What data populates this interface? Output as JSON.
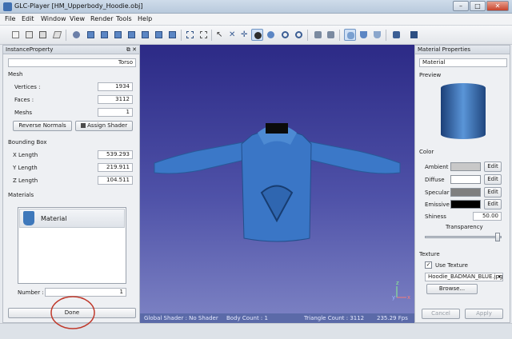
{
  "window": {
    "title": "GLC-Player [HM_Upperbody_Hoodie.obj]"
  },
  "menu": [
    "File",
    "Edit",
    "Window",
    "View",
    "Render",
    "Tools",
    "Help"
  ],
  "toolbar": {
    "icons": [
      "new-icon",
      "open-icon",
      "save-icon",
      "reload-icon",
      "print-icon",
      "front-view-icon",
      "back-view-icon",
      "left-view-icon",
      "right-view-icon",
      "top-view-icon",
      "bottom-view-icon",
      "iso-view-icon",
      "select-icon",
      "zoom-window-icon",
      "select-arrow-icon",
      "pan-icon",
      "move-icon",
      "orbit-icon",
      "turn-icon",
      "zoom-in-icon",
      "zoom-out-icon",
      "snapshot-icon",
      "fullscreen-icon",
      "instance-properties-icon",
      "material-icon",
      "shader-icon",
      "camera-icon",
      "settings-icon"
    ]
  },
  "instance_panel": {
    "title": "InstanceProperty",
    "name_value": "Torso",
    "mesh_title": "Mesh",
    "vertices_label": "Vertices :",
    "vertices_value": "1934",
    "faces_label": "Faces :",
    "faces_value": "3112",
    "meshs_label": "Meshs",
    "meshs_value": "1",
    "reverse_normals": "Reverse Normals",
    "assign_shader": "Assign Shader",
    "bbox_title": "Bounding Box",
    "x_label": "X Length",
    "x_value": "539.293",
    "y_label": "Y Length",
    "y_value": "219.911",
    "z_label": "Z Length",
    "z_value": "104.511",
    "materials_title": "Materials",
    "material_item": "Material",
    "number_label": "Number :",
    "number_value": "1",
    "done": "Done"
  },
  "status": {
    "shader": "Global Shader : No Shader",
    "body": "Body Count : 1",
    "triangle": "Triangle Count : 3112",
    "fps": "235.29 Fps"
  },
  "axes": {
    "x": "x",
    "y": "y",
    "z": "z"
  },
  "material_panel": {
    "title": "Material Properties",
    "name_value": "Material",
    "preview_title": "Preview",
    "color_title": "Color",
    "ambient_label": "Ambient",
    "diffuse_label": "Diffuse",
    "specular_label": "Specular",
    "emissive_label": "Emissive",
    "edit": "Edit",
    "shiness_label": "Shiness",
    "shiness_value": "50.00",
    "transparency_label": "Transparency",
    "transparency_level": 1.0,
    "texture_title": "Texture",
    "use_texture_label": "Use Texture",
    "use_texture_checked": true,
    "texture_file": "Hoodie_BADMAN_BLUE.jpg",
    "browse": "Browse...",
    "cancel": "Cancel",
    "apply": "Apply",
    "colors": {
      "ambient": "#c8c8c8",
      "diffuse": "#ffffff",
      "specular": "#7f7f7f",
      "emissive": "#000000"
    }
  }
}
